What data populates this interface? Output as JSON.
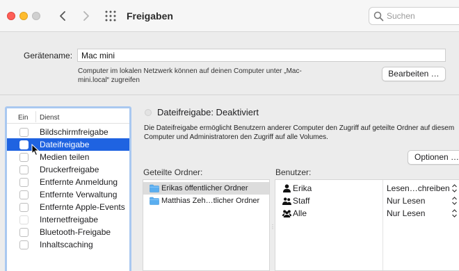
{
  "window": {
    "title": "Freigaben",
    "search_placeholder": "Suchen"
  },
  "device": {
    "label": "Gerätename:",
    "value": "Mac mini",
    "note": "Computer im lokalen Netzwerk können auf deinen Computer unter „Mac-mini.local“ zugreifen",
    "edit_button": "Bearbeiten …"
  },
  "services": {
    "col_on": "Ein",
    "col_service": "Dienst",
    "items": [
      {
        "label": "Bildschirmfreigabe",
        "checked": false
      },
      {
        "label": "Dateifreigabe",
        "checked": false,
        "selected": true
      },
      {
        "label": "Medien teilen",
        "checked": false
      },
      {
        "label": "Druckerfreigabe",
        "checked": false
      },
      {
        "label": "Entfernte Anmeldung",
        "checked": false
      },
      {
        "label": "Entfernte Verwaltung",
        "checked": false
      },
      {
        "label": "Entfernte Apple-Events",
        "checked": false
      },
      {
        "label": "Internetfreigabe",
        "checked": false,
        "disabled": true
      },
      {
        "label": "Bluetooth-Freigabe",
        "checked": false
      },
      {
        "label": "Inhaltscaching",
        "checked": false
      }
    ]
  },
  "detail": {
    "status": "Dateifreigabe: Deaktiviert",
    "description": "Die Dateifreigabe ermöglicht Benutzern anderer Computer den Zugriff auf geteilte Ordner auf diesem Computer und Administratoren den Zugriff auf alle Volumes.",
    "options_button": "Optionen …",
    "folders_header": "Geteilte Ordner:",
    "users_header": "Benutzer:",
    "folders": [
      {
        "label": "Erikas öffentlicher Ordner",
        "selected": true
      },
      {
        "label": "Matthias Zeh…tlicher Ordner"
      }
    ],
    "users": [
      {
        "name": "Erika",
        "permission": "Lesen…chreiben",
        "icon": "person-icon"
      },
      {
        "name": "Staff",
        "permission": "Nur Lesen",
        "icon": "group-icon"
      },
      {
        "name": "Alle",
        "permission": "Nur Lesen",
        "icon": "everyone-icon"
      }
    ]
  },
  "colors": {
    "selection": "#1f63e1",
    "focus_ring": "#a9c8f0",
    "folder": "#5aaef0"
  }
}
